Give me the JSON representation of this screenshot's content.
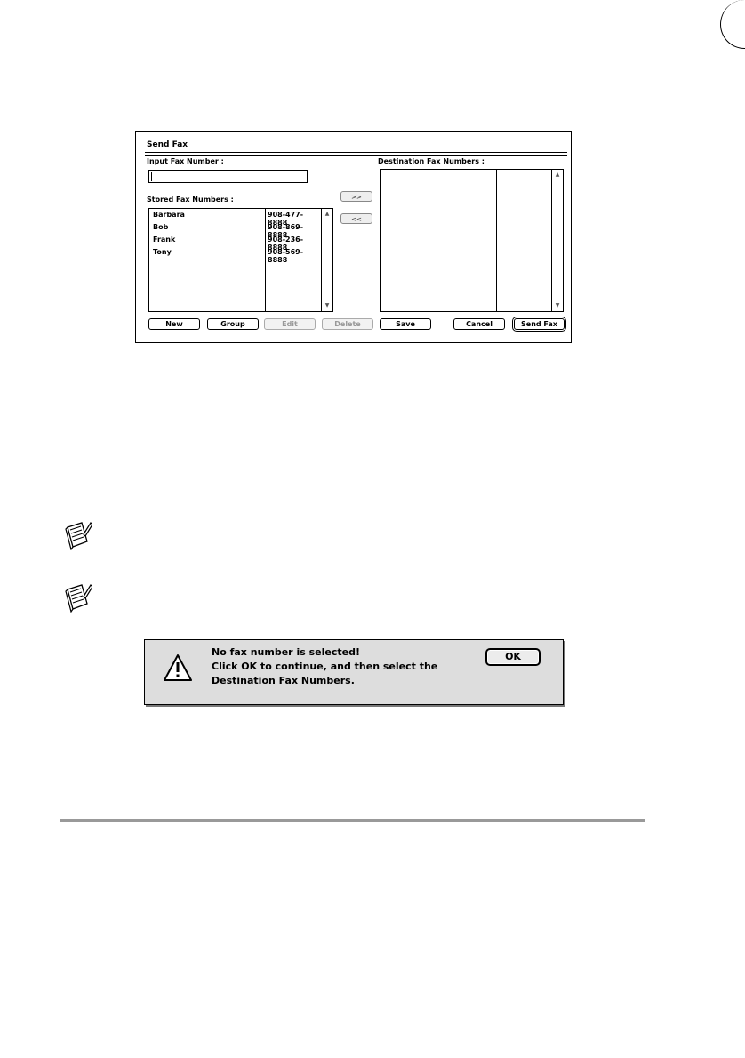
{
  "send_fax_dialog": {
    "title": "Send Fax",
    "input_label": "Input Fax Number :",
    "input_value": "",
    "stored_label": "Stored Fax Numbers :",
    "destination_label": "Destination Fax Numbers :",
    "stored_entries": [
      {
        "name": "Barbara",
        "number": "908-477-8888"
      },
      {
        "name": "Bob",
        "number": "908-869-8888"
      },
      {
        "name": "Frank",
        "number": "908-236-8888"
      },
      {
        "name": "Tony",
        "number": "908-569-8888"
      }
    ],
    "add_label": ">>",
    "remove_label": "<<",
    "buttons": {
      "new": "New",
      "group": "Group",
      "edit": "Edit",
      "delete": "Delete",
      "save": "Save",
      "cancel": "Cancel",
      "send_fax": "Send Fax"
    }
  },
  "alert_dialog": {
    "line1": "No fax number is selected!",
    "line2": "Click OK to continue, and then select the",
    "line3": "Destination Fax Numbers.",
    "ok_label": "OK"
  },
  "icons": {
    "note": "note-icon",
    "warning": "warning-icon",
    "scroll_up": "scroll-up-icon",
    "scroll_down": "scroll-down-icon"
  }
}
